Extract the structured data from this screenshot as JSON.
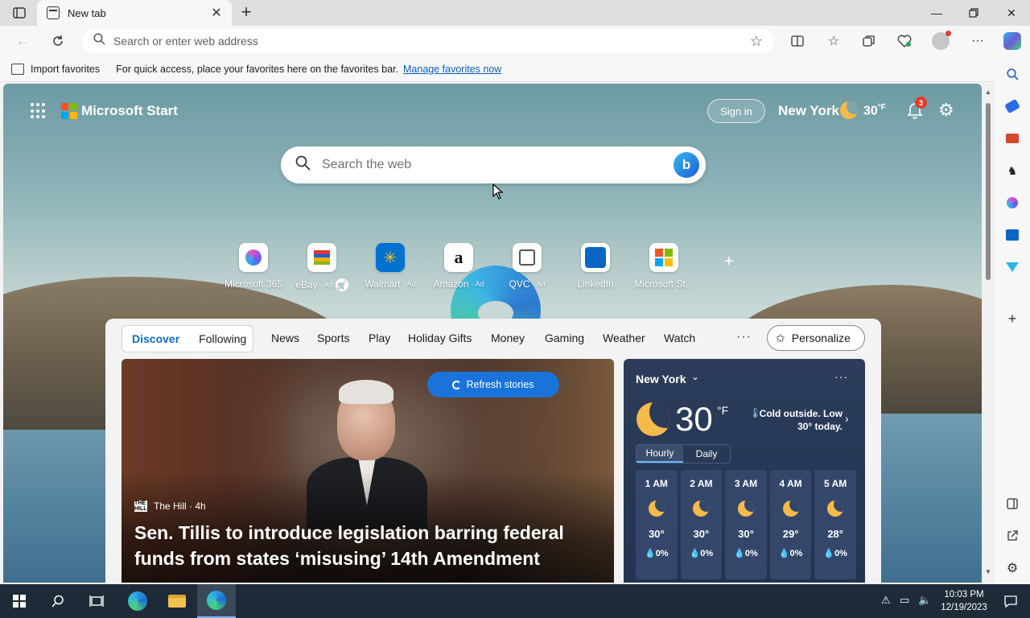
{
  "browser": {
    "tab_title": "New tab",
    "address_placeholder": "Search or enter web address",
    "favorites": {
      "import_label": "Import favorites",
      "hint": "For quick access, place your favorites here on the favorites bar.",
      "manage_link": "Manage favorites now"
    }
  },
  "header": {
    "brand": "Microsoft Start",
    "sign_in": "Sign in",
    "city": "New York",
    "temp": "30",
    "unit": "°F",
    "notification_count": "3"
  },
  "search": {
    "placeholder": "Search the web",
    "bing_icon": "b"
  },
  "quick_links": [
    {
      "label": "Microsoft 365",
      "ad": "",
      "icon": "m365-icon"
    },
    {
      "label": "eBay",
      "ad": "· Ad",
      "icon": "ebay-icon"
    },
    {
      "label": "Walmart",
      "ad": "· Ad",
      "icon": "walmart-icon"
    },
    {
      "label": "Amazon",
      "ad": "· Ad",
      "icon": "amazon-icon"
    },
    {
      "label": "QVC",
      "ad": "· Ad",
      "icon": "qvc-icon"
    },
    {
      "label": "LinkedIn",
      "ad": "",
      "icon": "linkedin-icon"
    },
    {
      "label": "Microsoft St...",
      "ad": "",
      "icon": "microsoft-store-icon"
    }
  ],
  "feed": {
    "tabs": [
      "Discover",
      "Following"
    ],
    "nav": [
      "News",
      "Sports",
      "Play",
      "Holiday Gifts",
      "Money",
      "Gaming",
      "Weather",
      "Watch"
    ],
    "more": "···",
    "personalize": "Personalize",
    "refresh": "Refresh stories",
    "source": "The Hill · 4h",
    "source_logo": "THE HILL",
    "headline": "Sen. Tillis to introduce legislation barring federal funds from states ‘misusing’ 14th Amendment"
  },
  "weather": {
    "city": "New York",
    "temp": "30",
    "unit": "°F",
    "description": "Cold outside. Low 30° today.",
    "tabs": [
      "Hourly",
      "Daily"
    ],
    "hours": [
      {
        "time": "1 AM",
        "temp": "30°",
        "precip": "0%"
      },
      {
        "time": "2 AM",
        "temp": "30°",
        "precip": "0%"
      },
      {
        "time": "3 AM",
        "temp": "30°",
        "precip": "0%"
      },
      {
        "time": "4 AM",
        "temp": "29°",
        "precip": "0%"
      },
      {
        "time": "5 AM",
        "temp": "28°",
        "precip": "0%"
      }
    ]
  },
  "taskbar": {
    "time": "10:03 PM",
    "date": "12/19/2023"
  },
  "colors": {
    "accent": "#0f6cbd",
    "refresh_button": "#1a73d9",
    "moon": "#f6b94a",
    "notification_badge": "#e03e2d"
  }
}
